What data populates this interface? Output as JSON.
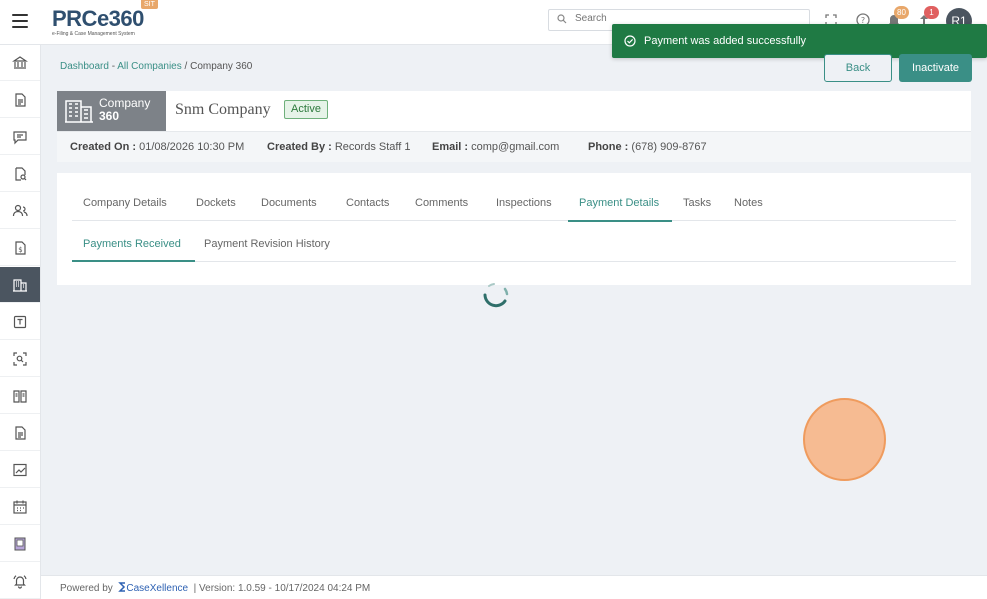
{
  "app": {
    "logo_text": "PRCe360",
    "logo_subtitle": "e-Filing & Case Management System",
    "env_badge": "SIT"
  },
  "header": {
    "search_placeholder": "Search",
    "notifications_count": "80",
    "alerts_count": "1",
    "avatar_initials": "R1"
  },
  "toast": {
    "message": "Payment was added successfully"
  },
  "breadcrumb": {
    "dashboard": "Dashboard",
    "sep1": " - ",
    "companies": "All Companies",
    "sep2": " / ",
    "current": "Company 360"
  },
  "actions": {
    "back": "Back",
    "inactivate": "Inactivate"
  },
  "company": {
    "label": "Company",
    "id": "360",
    "name": "Snm Company",
    "status": "Active",
    "created_on_label": "Created On :",
    "created_on": "01/08/2026 10:30 PM",
    "created_by_label": "Created By :",
    "created_by": "Records Staff 1",
    "email_label": "Email :",
    "email": "comp@gmail.com",
    "phone_label": "Phone :",
    "phone": "(678) 909-8767"
  },
  "tabs": [
    {
      "label": "Company Details"
    },
    {
      "label": "Dockets"
    },
    {
      "label": "Documents"
    },
    {
      "label": "Contacts"
    },
    {
      "label": "Comments"
    },
    {
      "label": "Inspections"
    },
    {
      "label": "Payment Details"
    },
    {
      "label": "Tasks"
    },
    {
      "label": "Notes"
    }
  ],
  "subtabs": [
    {
      "label": "Payments Received"
    },
    {
      "label": "Payment Revision History"
    }
  ],
  "footer": {
    "powered_by": "Powered by",
    "brand": "CaseXellence",
    "version": "|  Version: 1.0.59 - 10/17/2024 04:24 PM"
  },
  "colors": {
    "accent": "#3a8f86",
    "toast": "#1f7a44",
    "sidebar_active": "#4b5560"
  }
}
